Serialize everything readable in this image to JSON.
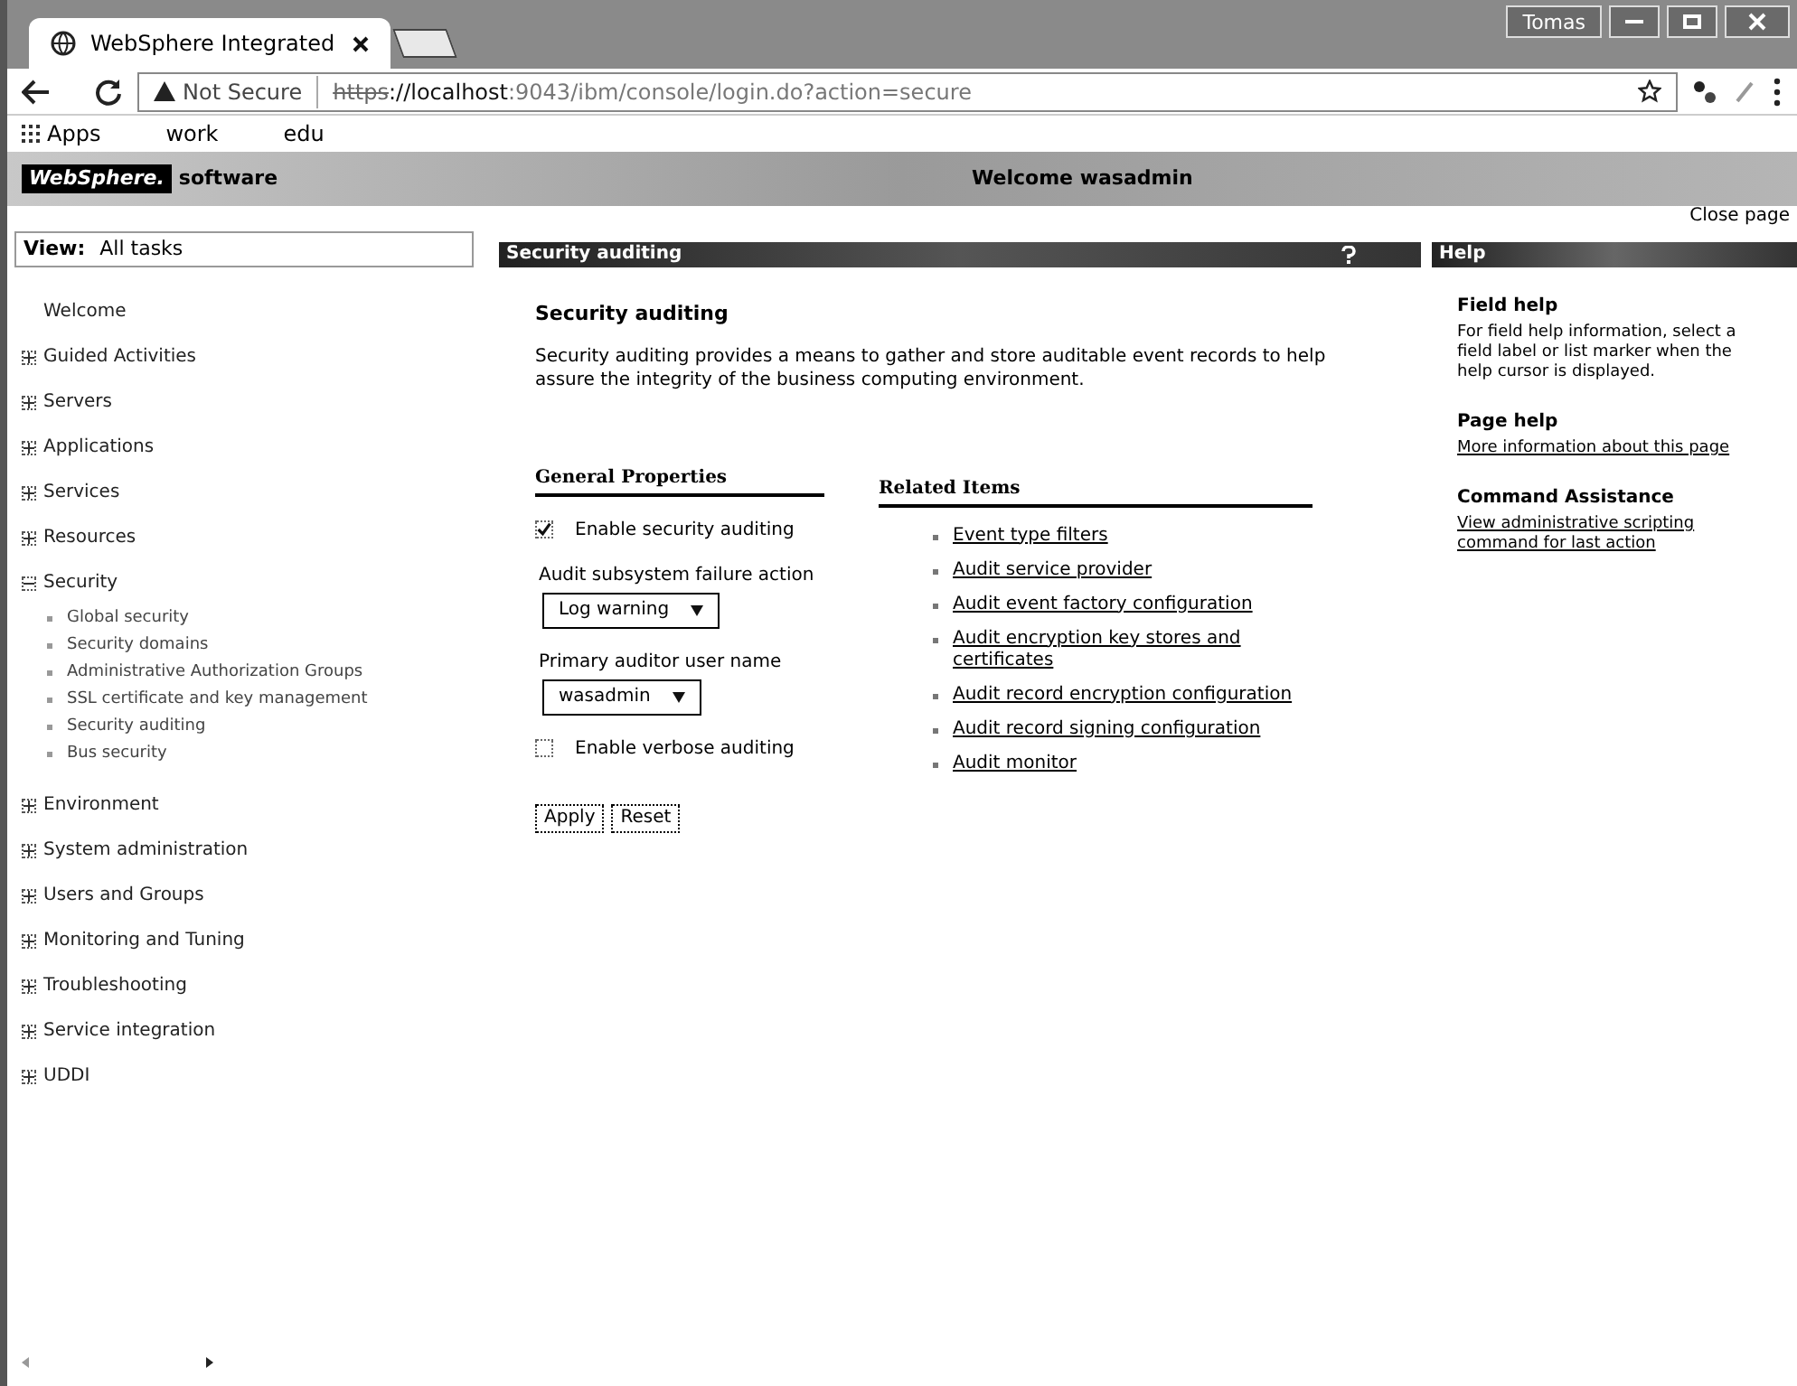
{
  "browser": {
    "profile": "Tomas",
    "tabs": [
      {
        "title": "WebSphere Integrated",
        "selected": true
      }
    ],
    "security_label": "Not Secure",
    "url_scheme": "https",
    "url_host": "://localhost",
    "url_rest": ":9043/ibm/console/login.do?action=secure",
    "bookmarks": [
      {
        "label": "Apps",
        "kind": "apps"
      },
      {
        "label": "work",
        "kind": "folder"
      },
      {
        "label": "edu",
        "kind": "folder"
      }
    ]
  },
  "banner": {
    "brand": "WebSphere.",
    "product": "software",
    "welcome": "Welcome wasadmin",
    "close_page": "Close page"
  },
  "nav": {
    "view_label": "View:",
    "view_value": "All tasks",
    "items": [
      {
        "label": "Welcome",
        "kind": "leaf"
      },
      {
        "label": "Guided Activities",
        "kind": "group",
        "expanded": false
      },
      {
        "label": "Servers",
        "kind": "group",
        "expanded": false
      },
      {
        "label": "Applications",
        "kind": "group",
        "expanded": false
      },
      {
        "label": "Services",
        "kind": "group",
        "expanded": false
      },
      {
        "label": "Resources",
        "kind": "group",
        "expanded": false
      },
      {
        "label": "Security",
        "kind": "group",
        "expanded": true,
        "children": [
          {
            "label": "Global security"
          },
          {
            "label": "Security domains"
          },
          {
            "label": "Administrative Authorization Groups"
          },
          {
            "label": "SSL certificate and key management"
          },
          {
            "label": "Security auditing"
          },
          {
            "label": "Bus security"
          }
        ]
      },
      {
        "label": "Environment",
        "kind": "group",
        "expanded": false
      },
      {
        "label": "System administration",
        "kind": "group",
        "expanded": false
      },
      {
        "label": "Users and Groups",
        "kind": "group",
        "expanded": false
      },
      {
        "label": "Monitoring and Tuning",
        "kind": "group",
        "expanded": false
      },
      {
        "label": "Troubleshooting",
        "kind": "group",
        "expanded": false
      },
      {
        "label": "Service integration",
        "kind": "group",
        "expanded": false
      },
      {
        "label": "UDDI",
        "kind": "group",
        "expanded": false
      }
    ]
  },
  "panel": {
    "title": "Security auditing",
    "heading": "Security auditing",
    "description": "Security auditing provides a means to gather and store auditable event records to help assure the integrity of the business computing environment.",
    "general_properties": {
      "title": "General Properties",
      "fields": [
        {
          "kind": "checkbox",
          "label": "Enable security auditing",
          "checked": true
        },
        {
          "kind": "select",
          "label": "Audit subsystem failure action",
          "value": "Log warning"
        },
        {
          "kind": "select",
          "label": "Primary auditor user name",
          "value": "wasadmin"
        },
        {
          "kind": "checkbox",
          "label": "Enable verbose auditing",
          "checked": false
        }
      ]
    },
    "buttons": [
      "Apply",
      "Reset"
    ],
    "related_items": {
      "title": "Related Items",
      "links": [
        "Event type filters",
        "Audit service provider",
        "Audit event factory configuration",
        "Audit encryption key stores and certificates",
        "Audit record encryption configuration",
        "Audit record signing configuration",
        "Audit monitor"
      ]
    }
  },
  "help": {
    "title": "Help",
    "sections": [
      {
        "heading": "Field help",
        "text": "For field help information, select a field label or list marker when the help cursor is displayed.",
        "kind": "text"
      },
      {
        "heading": "Page help",
        "text": "More information about this page",
        "kind": "link"
      },
      {
        "heading": "Command Assistance",
        "text": "View administrative scripting command for last action",
        "kind": "link"
      }
    ]
  }
}
